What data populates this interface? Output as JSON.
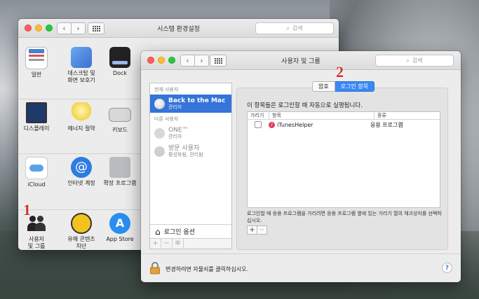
{
  "back_window": {
    "title": "시스템 환경설정",
    "search_placeholder": "검색",
    "row1": [
      {
        "label": "일반"
      },
      {
        "label": "데스크탑 및\n화면 보호기"
      },
      {
        "label": "Dock"
      }
    ],
    "row2": [
      {
        "label": "디스플레이"
      },
      {
        "label": "에너지 절약"
      },
      {
        "label": "키보드"
      }
    ],
    "row3": [
      {
        "label": "iCloud"
      },
      {
        "label": "인터넷 계정"
      },
      {
        "label": "확장 프로그램"
      }
    ],
    "row4": [
      {
        "label": "사용자\n및 그룹"
      },
      {
        "label": "유해 콘텐츠\n차단"
      },
      {
        "label": "App Store"
      }
    ]
  },
  "front_window": {
    "title": "사용자 및 그룹",
    "search_placeholder": "검색",
    "sidebar": {
      "current_header": "현재 사용자",
      "current_user": {
        "name": "Back to the Mac",
        "role": "관리자"
      },
      "other_header": "다른 사용자",
      "others": [
        {
          "name": "ONE™",
          "role": "관리자"
        },
        {
          "name": "방문 사용자",
          "role": "활성화됨, 관리됨"
        }
      ],
      "login_options": "로그인 옵션",
      "tools": [
        "+",
        "−",
        "✲"
      ]
    },
    "tabs": [
      "암호",
      "로그인 항목"
    ],
    "panel": {
      "title": "이 항목들은 로그인할 때 자동으로 실행됩니다.",
      "columns": [
        "가리기",
        "항목",
        "종류"
      ],
      "rows": [
        {
          "hide": false,
          "item": "iTunesHelper",
          "kind": "응용 프로그램"
        }
      ],
      "instruction": "로그인할 때 응용 프로그램을 가리려면 응용 프로그램 옆에 있는 가리기 열의 체크상자를 선택하십시오.",
      "add": "+",
      "remove": "−"
    },
    "lock_text": "변경하려면 자물쇠를 클릭하십시오.",
    "help": "?"
  },
  "annotations": [
    "1",
    "2"
  ],
  "colors": {
    "accent": "#3b88f5",
    "selection": "#3574d8",
    "marker": "#d2302a"
  }
}
